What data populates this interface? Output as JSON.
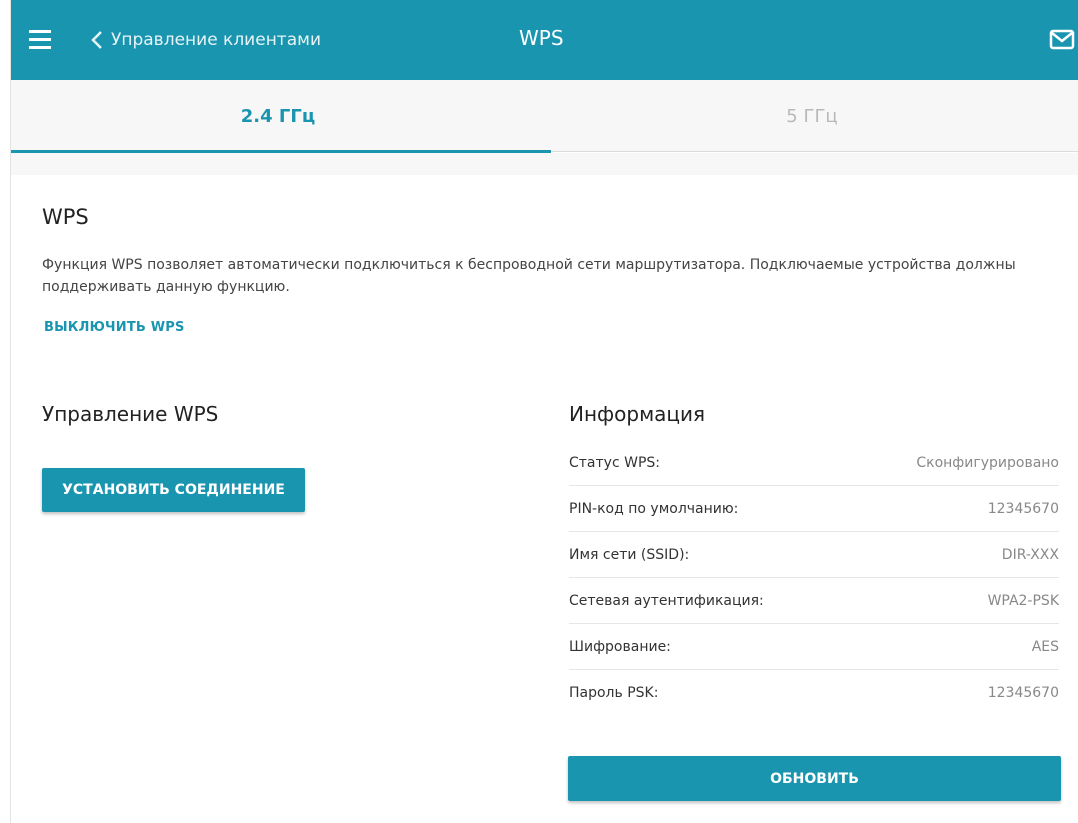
{
  "header": {
    "back_label": "Управление клиентами",
    "title": "WPS"
  },
  "tabs": [
    {
      "label": "2.4 ГГц",
      "active": true
    },
    {
      "label": "5 ГГц",
      "active": false
    }
  ],
  "wps": {
    "title": "WPS",
    "description": "Функция WPS позволяет автоматически подключиться к беспроводной сети маршрутизатора. Подключаемые устройства должны поддерживать данную функцию.",
    "disable_link": "ВЫКЛЮЧИТЬ WPS"
  },
  "management": {
    "title": "Управление WPS",
    "connect_button": "УСТАНОВИТЬ СОЕДИНЕНИЕ"
  },
  "info": {
    "title": "Информация",
    "rows": [
      {
        "label": "Статус WPS:",
        "value": "Сконфигурировано"
      },
      {
        "label": "PIN-код по умолчанию:",
        "value": "12345670"
      },
      {
        "label": "Имя сети (SSID):",
        "value": "DIR-XXX"
      },
      {
        "label": "Сетевая аутентификация:",
        "value": "WPA2-PSK"
      },
      {
        "label": "Шифрование:",
        "value": "AES"
      },
      {
        "label": "Пароль PSK:",
        "value": "12345670"
      }
    ],
    "refresh_button": "ОБНОВИТЬ"
  },
  "colors": {
    "accent": "#1a95b0",
    "inactive_tab": "#b9b9b9"
  },
  "icons": {
    "menu": "hamburger-icon",
    "back": "chevron-left-icon",
    "mail": "mail-icon"
  }
}
